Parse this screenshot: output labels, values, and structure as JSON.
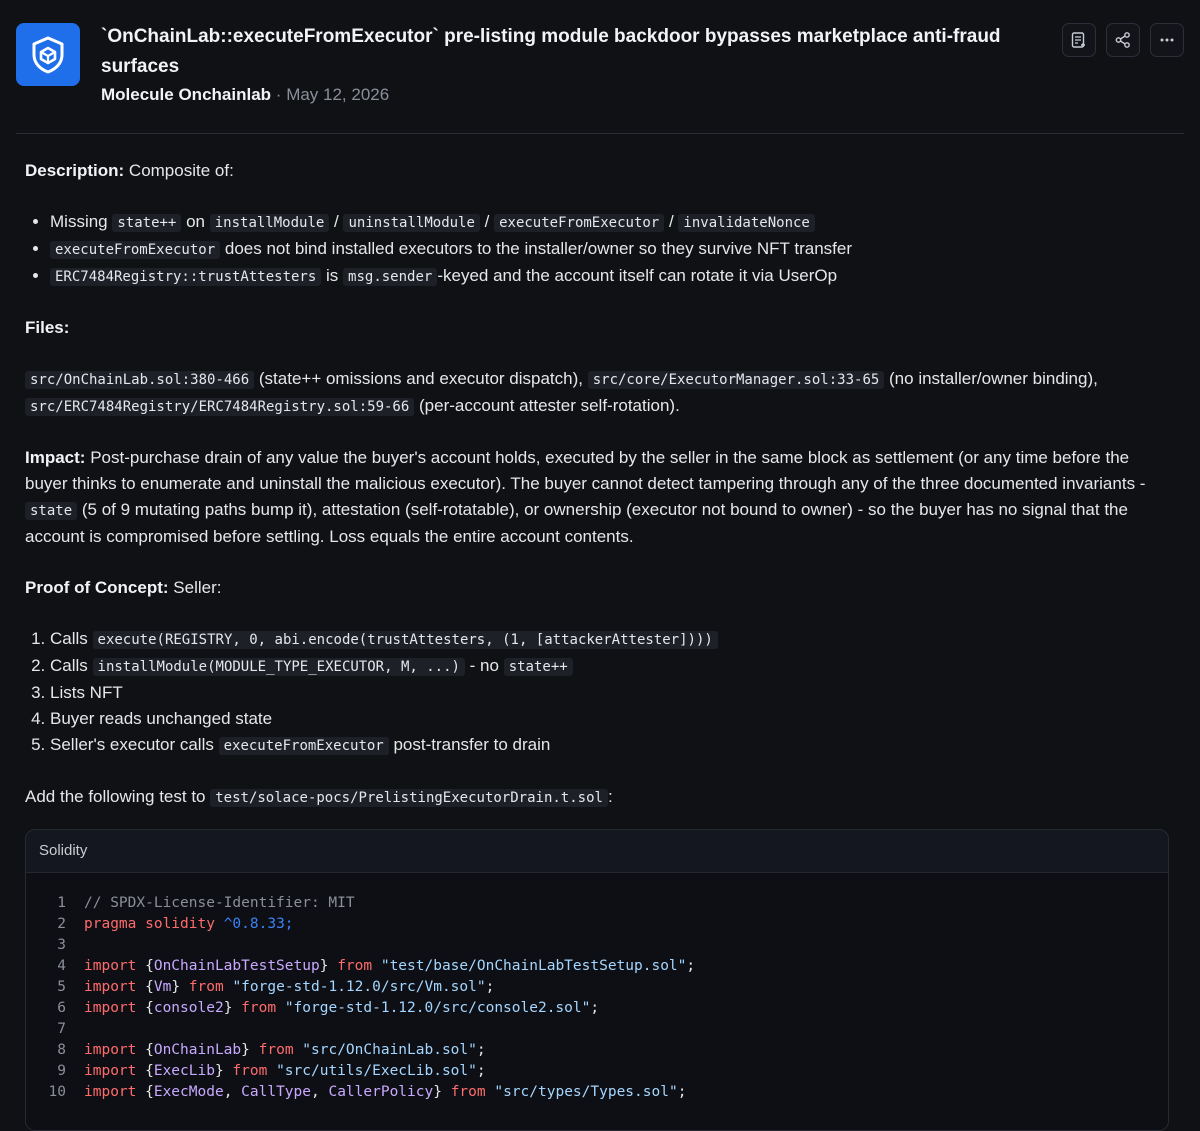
{
  "header": {
    "title": "`OnChainLab::executeFromExecutor` pre-listing module backdoor bypasses marketplace anti-fraud surfaces",
    "author": "Molecule Onchainlab",
    "separator": "·",
    "date": "May 12, 2026",
    "logo_icon": "shield-cube-icon",
    "actions": [
      {
        "name": "add-note-button",
        "icon": "note-plus-icon"
      },
      {
        "name": "share-button",
        "icon": "share-icon"
      },
      {
        "name": "more-button",
        "icon": "ellipsis-icon"
      }
    ]
  },
  "description": {
    "label": "Description:",
    "text": " Composite of:",
    "bullets": [
      {
        "pre": "Missing ",
        "c1": "state++",
        "mid1": " on ",
        "c2": "installModule",
        "s1": " / ",
        "c3": "uninstallModule",
        "s2": " / ",
        "c4": "executeFromExecutor",
        "s3": " / ",
        "c5": "invalidateNonce"
      },
      {
        "c1": "executeFromExecutor",
        "text": " does not bind installed executors to the installer/owner so they survive NFT transfer"
      },
      {
        "c1": "ERC7484Registry::trustAttesters",
        "mid": " is ",
        "c2": "msg.sender",
        "text": "-keyed and the account itself can rotate it via UserOp"
      }
    ]
  },
  "files": {
    "label": "Files:",
    "f1": "src/OnChainLab.sol:380-466",
    "t1": " (state++ omissions and executor dispatch), ",
    "f2": "src/core/ExecutorManager.sol:33-65",
    "t2": " (no installer/owner binding), ",
    "f3": "src/ERC7484Registry/ERC7484Registry.sol:59-66",
    "t3": " (per-account attester self-rotation)."
  },
  "impact": {
    "label": "Impact:",
    "t1": " Post-purchase drain of any value the buyer's account holds, executed by the seller in the same block as settlement (or any time before the buyer thinks to enumerate and uninstall the malicious executor). The buyer cannot detect tampering through any of the three documented invariants - ",
    "c1": "state",
    "t2": " (5 of 9 mutating paths bump it), attestation (self-rotatable), or ownership (executor not bound to owner) - so the buyer has no signal that the account is compromised before settling. Loss equals the entire account contents."
  },
  "poc": {
    "label": "Proof of Concept:",
    "text": " Seller:",
    "steps": [
      {
        "pre": "Calls ",
        "c1": "execute(REGISTRY, 0, abi.encode(trustAttesters, (1, [attackerAttester])))"
      },
      {
        "pre": "Calls ",
        "c1": "installModule(MODULE_TYPE_EXECUTOR, M, ...)",
        "mid": " - no ",
        "c2": "state++"
      },
      {
        "pre": "Lists NFT"
      },
      {
        "pre": "Buyer reads unchanged state"
      },
      {
        "pre": "Seller's executor calls ",
        "c1": "executeFromExecutor",
        "post": " post-transfer to drain"
      }
    ],
    "add_pre": "Add the following test to ",
    "add_file": "test/solace-pocs/PrelistingExecutorDrain.t.sol",
    "add_post": ":"
  },
  "code": {
    "language": "Solidity",
    "lines": [
      {
        "n": "1",
        "tokens": [
          [
            "comment",
            "// SPDX-License-Identifier: MIT"
          ]
        ]
      },
      {
        "n": "2",
        "tokens": [
          [
            "keyword",
            "pragma solidity "
          ],
          [
            "number",
            "^0.8.33;"
          ]
        ]
      },
      {
        "n": "3",
        "tokens": []
      },
      {
        "n": "4",
        "tokens": [
          [
            "keyword",
            "import "
          ],
          [
            "plain",
            "{"
          ],
          [
            "ident",
            "OnChainLabTestSetup"
          ],
          [
            "plain",
            "} "
          ],
          [
            "keyword",
            "from "
          ],
          [
            "string",
            "\"test/base/OnChainLabTestSetup.sol\""
          ],
          [
            "plain",
            ";"
          ]
        ]
      },
      {
        "n": "5",
        "tokens": [
          [
            "keyword",
            "import "
          ],
          [
            "plain",
            "{"
          ],
          [
            "ident",
            "Vm"
          ],
          [
            "plain",
            "} "
          ],
          [
            "keyword",
            "from "
          ],
          [
            "string",
            "\"forge-std-1.12.0/src/Vm.sol\""
          ],
          [
            "plain",
            ";"
          ]
        ]
      },
      {
        "n": "6",
        "tokens": [
          [
            "keyword",
            "import "
          ],
          [
            "plain",
            "{"
          ],
          [
            "ident",
            "console2"
          ],
          [
            "plain",
            "} "
          ],
          [
            "keyword",
            "from "
          ],
          [
            "string",
            "\"forge-std-1.12.0/src/console2.sol\""
          ],
          [
            "plain",
            ";"
          ]
        ]
      },
      {
        "n": "7",
        "tokens": []
      },
      {
        "n": "8",
        "tokens": [
          [
            "keyword",
            "import "
          ],
          [
            "plain",
            "{"
          ],
          [
            "ident",
            "OnChainLab"
          ],
          [
            "plain",
            "} "
          ],
          [
            "keyword",
            "from "
          ],
          [
            "string",
            "\"src/OnChainLab.sol\""
          ],
          [
            "plain",
            ";"
          ]
        ]
      },
      {
        "n": "9",
        "tokens": [
          [
            "keyword",
            "import "
          ],
          [
            "plain",
            "{"
          ],
          [
            "ident",
            "ExecLib"
          ],
          [
            "plain",
            "} "
          ],
          [
            "keyword",
            "from "
          ],
          [
            "string",
            "\"src/utils/ExecLib.sol\""
          ],
          [
            "plain",
            ";"
          ]
        ]
      },
      {
        "n": "10",
        "tokens": [
          [
            "keyword",
            "import "
          ],
          [
            "plain",
            "{"
          ],
          [
            "ident",
            "ExecMode"
          ],
          [
            "plain",
            ", "
          ],
          [
            "ident",
            "CallType"
          ],
          [
            "plain",
            ", "
          ],
          [
            "ident",
            "CallerPolicy"
          ],
          [
            "plain",
            "} "
          ],
          [
            "keyword",
            "from "
          ],
          [
            "string",
            "\"src/types/Types.sol\""
          ],
          [
            "plain",
            ";"
          ]
        ]
      }
    ]
  }
}
